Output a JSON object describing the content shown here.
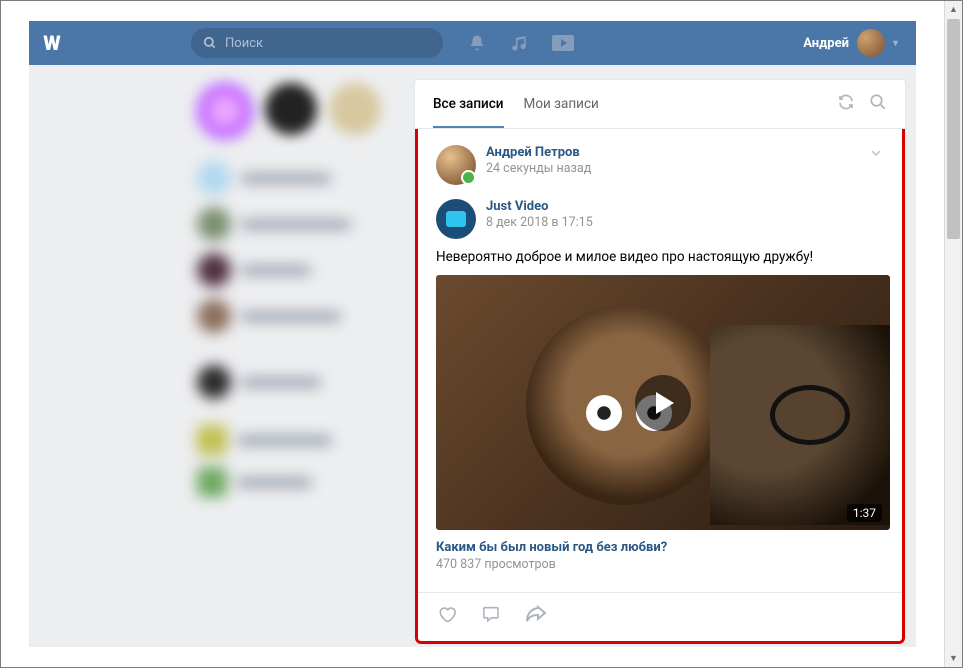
{
  "header": {
    "logo_text": "W",
    "search_placeholder": "Поиск",
    "username": "Андрей"
  },
  "tabs": {
    "all": "Все записи",
    "mine": "Мои записи"
  },
  "post": {
    "author_name": "Андрей Петров",
    "author_time": "24 секунды назад",
    "repost_source_name": "Just Video",
    "repost_source_time": "8 дек 2018 в 17:15",
    "text": "Невероятно доброе и милое видео про настоящую дружбу!",
    "video_duration": "1:37",
    "video_title": "Каким бы был новый год без любви?",
    "video_views": "470 837 просмотров"
  },
  "colors": {
    "brand": "#4a76a8",
    "link": "#2a5885",
    "bg": "#edeef0",
    "highlight": "#d90000"
  }
}
